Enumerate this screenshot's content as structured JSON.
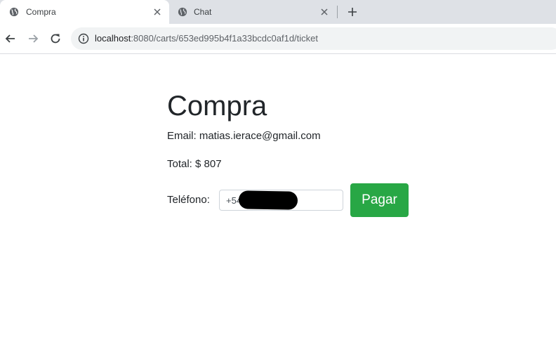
{
  "browser": {
    "tabs": [
      {
        "title": "Compra",
        "active": true,
        "icon": "globe-icon"
      },
      {
        "title": "Chat",
        "active": false,
        "icon": "globe-icon"
      }
    ],
    "address": {
      "host": "localhost",
      "path": ":8080/carts/653ed995b4f1a33bcdc0af1d/ticket"
    }
  },
  "page": {
    "title": "Compra",
    "email": "Email: matias.ierace@gmail.com",
    "total": "Total: $ 807",
    "phone_label": "Teléfono:",
    "phone_value": "+54",
    "pay_button": "Pagar"
  },
  "colors": {
    "accent_button": "#28a745",
    "tabstrip": "#dee1e6",
    "omnibox": "#f1f3f4"
  }
}
